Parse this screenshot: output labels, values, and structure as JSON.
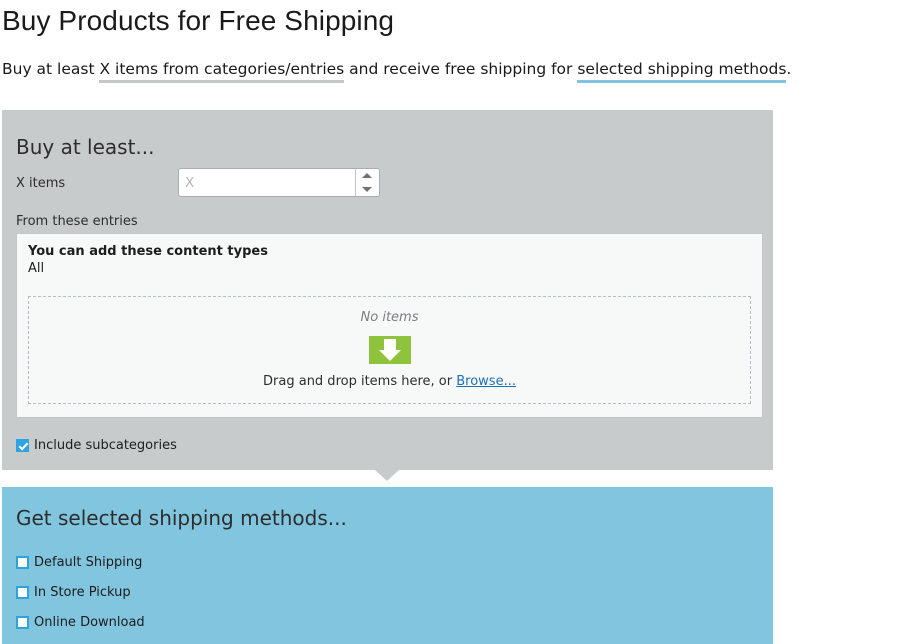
{
  "page": {
    "title": "Buy Products for Free Shipping",
    "sentence": {
      "part1": "Buy at least ",
      "highlight_gray": "X items from categories/entries",
      "part2": " and receive free shipping for ",
      "highlight_blue": "selected shipping methods",
      "part3": "."
    }
  },
  "colors": {
    "panel_gray": "#c8cbcb",
    "panel_blue": "#81c5de",
    "accent_blue": "#2ea3e0",
    "underline_gray": "#c6c8c8",
    "underline_blue": "#7fc3de",
    "drop_icon_green": "#8fc23d",
    "link_blue": "#1f6fb5"
  },
  "condition_panel": {
    "heading": "Buy at least...",
    "quantity_field": {
      "label": "X items",
      "value": "",
      "placeholder": "X",
      "stepper_up_icon": "triangle-up-icon",
      "stepper_down_icon": "triangle-down-icon"
    },
    "entries_label": "From these entries",
    "entries_box": {
      "content_types_title": "You can add these content types",
      "content_types_value": "All",
      "dropzone": {
        "empty_text": "No items",
        "icon": "download-arrow-icon",
        "hint_prefix": "Drag and drop items here, or ",
        "browse_link": "Browse..."
      }
    },
    "include_subcategories": {
      "label": "Include subcategories",
      "checked": true
    }
  },
  "action_panel": {
    "heading": "Get selected shipping methods...",
    "shipping_methods": [
      {
        "label": "Default Shipping",
        "checked": false
      },
      {
        "label": "In Store Pickup",
        "checked": false
      },
      {
        "label": "Online Download",
        "checked": false
      }
    ]
  }
}
